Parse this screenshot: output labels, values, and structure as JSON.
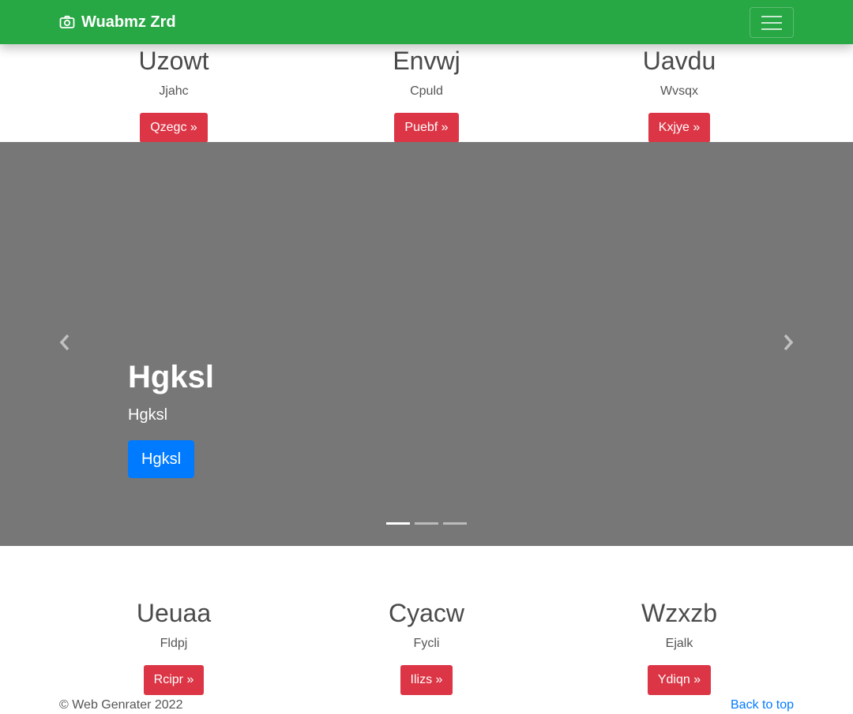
{
  "navbar": {
    "brand": "Wuabmz Zrd",
    "brand_icon": "camera-icon",
    "toggler_icon": "hamburger-menu-icon"
  },
  "top_columns": [
    {
      "heading": "Uzowt",
      "text": "Jjahc",
      "button": "Qzegc »"
    },
    {
      "heading": "Envwj",
      "text": "Cpuld",
      "button": "Puebf »"
    },
    {
      "heading": "Uavdu",
      "text": "Wvsqx",
      "button": "Kxjye »"
    }
  ],
  "carousel": {
    "title": "Hgksl",
    "subtitle": "Hgksl",
    "button": "Hgksl",
    "slide_count": 3,
    "active_slide": 1,
    "prev_icon": "chevron-left-icon",
    "next_icon": "chevron-right-icon"
  },
  "bottom_columns": [
    {
      "heading": "Ueuaa",
      "text": "Fldpj",
      "button": "Rcipr »"
    },
    {
      "heading": "Cyacw",
      "text": "Fycli",
      "button": "Ilizs »"
    },
    {
      "heading": "Wzxzb",
      "text": "Ejalk",
      "button": "Ydiqn »"
    }
  ],
  "footer": {
    "copyright": "© Web Genrater 2022",
    "back_to_top": "Back to top"
  },
  "colors": {
    "navbar": "#28a745",
    "danger": "#dc3545",
    "primary": "#007bff",
    "carousel_bg": "#777777"
  }
}
